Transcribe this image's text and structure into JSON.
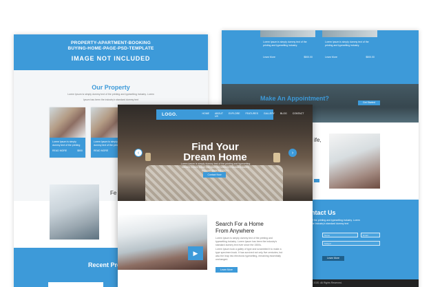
{
  "colors": {
    "accent": "#3d9ad9",
    "dark": "#222222",
    "white": "#ffffff"
  },
  "left_page": {
    "banner_line1": "PROPERTY-APARTMENT-BOOKING",
    "banner_line2": "BUYING-HOME-PAGE-PSD-TEMPLATE",
    "banner_notice": "IMAGE NOT INCLUDED",
    "section_title": "Our Property",
    "section_sub1": "Lorem Ipsum is simply dummy text of the printing and typesetting industry. Lorem",
    "section_sub2": "Ipsum has been the industry's standard dummy text",
    "cards": [
      {
        "text": "Lorem Ipsum is simply dummy text of the printing",
        "link": "READ MORE",
        "price": "$500"
      },
      {
        "text": "Lorem Ipsum is simply dummy text of the printing",
        "link": "READ MORE",
        "price": "$500"
      }
    ],
    "feature_title": "Fe",
    "recent_title": "Recent Pro"
  },
  "right_page": {
    "cards": [
      {
        "text": "Lorem Ipsum is simply dummy text of the printing and typesetting industry.",
        "link": "Learn More",
        "price": "$500.00"
      },
      {
        "text": "Lorem Ipsum is simply dummy text of the printing and typesetting industry.",
        "link": "Learn More",
        "price": "$500.00"
      }
    ],
    "appointment_title": "Make An Appointment?",
    "appointment_button": "Get Started",
    "life_title": "ife,",
    "contact_title": "ntact Us",
    "contact_line1": "of the printing and typesetting industry. Lorem",
    "contact_line2": "the industry's standard dummy text",
    "fields": [
      "Name",
      "Email",
      "Subject"
    ],
    "send_button": "Learn More",
    "copyright": "© 2020. All Rights Reserved."
  },
  "front_page": {
    "logo": "LOGO.",
    "nav": [
      "HOME",
      "ABOUT US",
      "EXPLORE",
      "FEATURES",
      "GALLERY",
      "BLOG",
      "CONTACT"
    ],
    "hero_title_line1": "Find Your",
    "hero_title_line2": "Dream Home",
    "hero_sub": "Lorem Ipsum is simply dummy text of the printing and typesetting industry. Lorem Ipsum has been the industry's standard dummy text ever since the 1500s.",
    "hero_button": "Contact Now",
    "arrow_left": "‹",
    "arrow_right": "›",
    "search_title_line1": "Search For a Home",
    "search_title_line2": "From Anywhere",
    "search_p1": "Lorem Ipsum is simply dummy text of the printing and typesetting industry. Lorem Ipsum has been the industry's standard dummy text ever since the 1500s.",
    "search_p2": "Lorem Ipsum took a galley of type and scrambled it to make a type specimen book. It has survived not only five centuries, but also the leap into electronic typesetting, remaining essentially unchanged.",
    "search_button": "Learn More",
    "play_icon": "▶"
  }
}
